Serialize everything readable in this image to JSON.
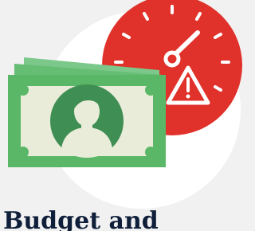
{
  "caption": {
    "text": "Budget and"
  },
  "icons": {
    "money": "banknote-icon",
    "gauge": "speedometer-icon",
    "warning": "warning-triangle-icon",
    "person": "portrait-icon"
  },
  "colors": {
    "page_background": "#f1f1f1",
    "circle_background": "#ffffff",
    "gauge_red": "#e0312a",
    "gauge_white": "#ffffff",
    "banknote_green": "#5bb768",
    "banknote_back_green": "#7cc88a",
    "banknote_dark_green": "#3f8e53",
    "banknote_cream": "#e9ecd8",
    "caption_text": "#0f1f3a"
  }
}
